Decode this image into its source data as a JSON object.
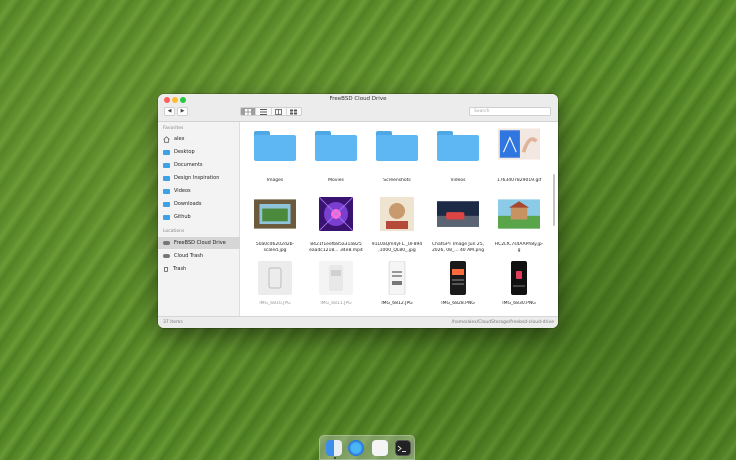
{
  "window": {
    "title": "FreeBSD Cloud Drive"
  },
  "toolbar": {
    "back_glyph": "◀",
    "forward_glyph": "▶",
    "views": [
      "icon-view",
      "list-view",
      "column-view",
      "gallery-view"
    ],
    "search_placeholder": "Search"
  },
  "sidebar": {
    "favorites_header": "Favorites",
    "favorites": [
      "alex",
      "Desktop",
      "Documents",
      "Design Inspiration",
      "Videos",
      "Downloads",
      "Github"
    ],
    "locations_header": "Locations",
    "locations": [
      "FreeBSD Cloud Drive",
      "Cloud Trash",
      "Trash"
    ]
  },
  "files": [
    {
      "name": "Images",
      "kind": "folder"
    },
    {
      "name": "Movies",
      "kind": "folder"
    },
    {
      "name": "Screenshots",
      "kind": "folder"
    },
    {
      "name": "Videos",
      "kind": "folder"
    },
    {
      "name": "1763407829019.gif",
      "kind": "image"
    },
    {
      "name": "50a0cd6202d2b-",
      "name2": "scaled.jpg",
      "kind": "image"
    },
    {
      "name": "8421f1eefb85a31a825",
      "name2": "eaadc1218... 34e8.mp4",
      "kind": "video"
    },
    {
      "name": "91L0aQm4yFL._UF894",
      "name2": ",1000_QL80_.jpg",
      "kind": "image"
    },
    {
      "name": "ChatGPT Image Jun 25,",
      "name2": "2026, 08_... 40 AM.png",
      "kind": "image"
    },
    {
      "name": "HC2LfC7s4AAPh8y.jp-",
      "name2": "g",
      "kind": "image"
    },
    {
      "name": "IMG_6810.JPG",
      "kind": "image",
      "muted": true
    },
    {
      "name": "IMG_6811.JPG",
      "kind": "image",
      "muted": true
    },
    {
      "name": "IMG_6812.JPG",
      "kind": "image"
    },
    {
      "name": "IMG_6828.PNG",
      "kind": "image"
    },
    {
      "name": "IMG_6830.PNG",
      "kind": "image"
    }
  ],
  "status": {
    "count": "37 items",
    "path": "/home/alex/CloudStorage/freebsd-cloud-drive"
  }
}
